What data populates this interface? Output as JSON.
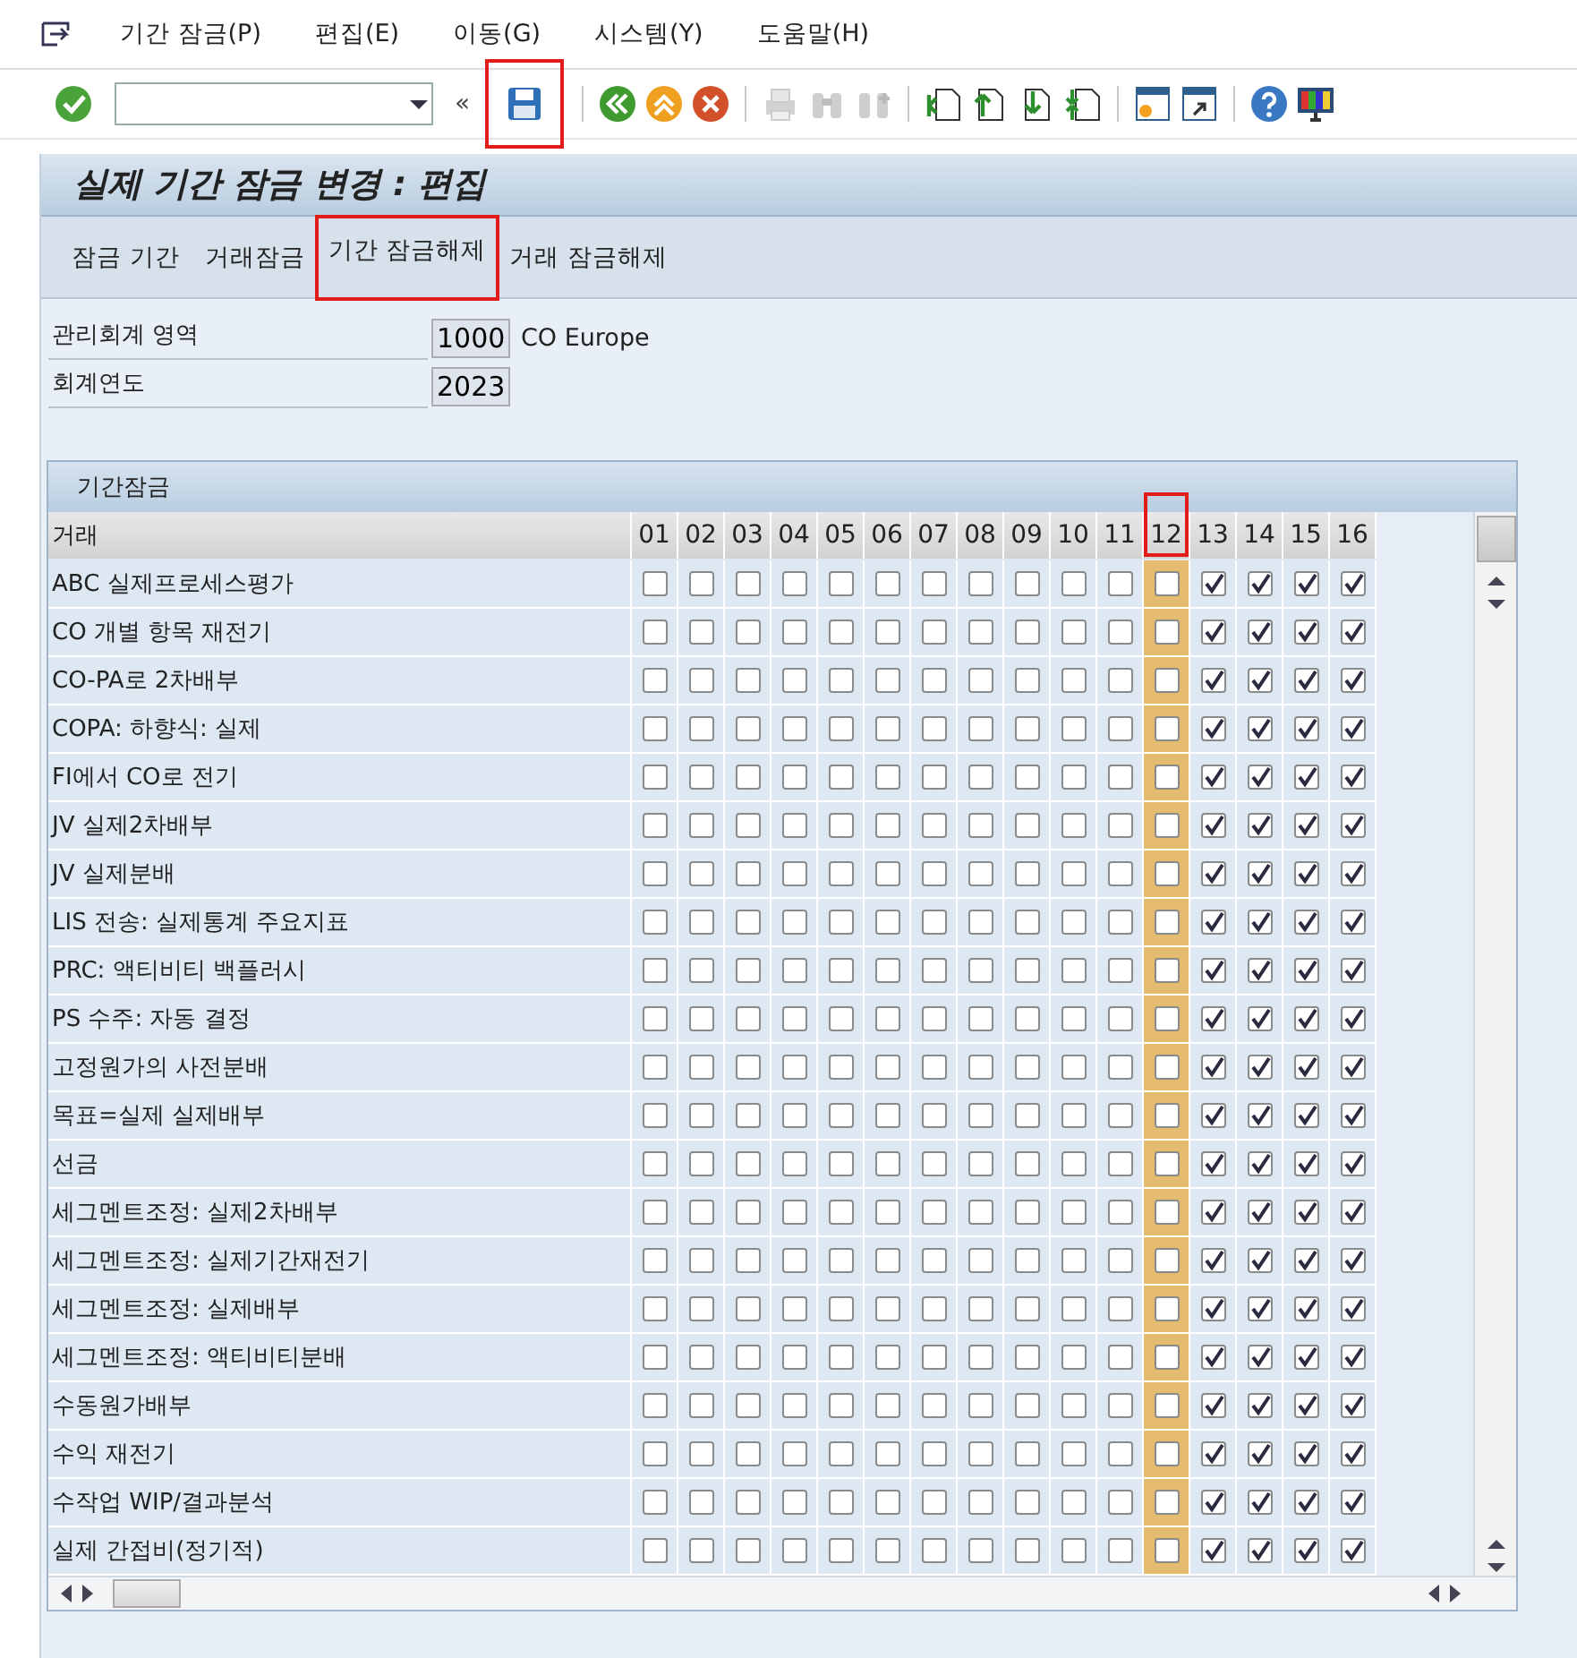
{
  "menu": [
    {
      "label": "기간 잠금(P)"
    },
    {
      "label": "편집(E)"
    },
    {
      "label": "이동(G)"
    },
    {
      "label": "시스템(Y)"
    },
    {
      "label": "도움말(H)"
    }
  ],
  "toolbar": {
    "collapse_glyph": "«",
    "buttons": [
      {
        "kind": "save",
        "disabled": false,
        "highlighted": true
      },
      {
        "kind": "sep"
      },
      {
        "kind": "back",
        "disabled": false,
        "highlighted": false
      },
      {
        "kind": "exit",
        "disabled": false,
        "highlighted": false
      },
      {
        "kind": "cancel",
        "disabled": false,
        "highlighted": false
      },
      {
        "kind": "sep"
      },
      {
        "kind": "print",
        "disabled": true,
        "highlighted": false
      },
      {
        "kind": "find",
        "disabled": true,
        "highlighted": false
      },
      {
        "kind": "find-next",
        "disabled": true,
        "highlighted": false
      },
      {
        "kind": "sep"
      },
      {
        "kind": "first-page",
        "disabled": false,
        "highlighted": false
      },
      {
        "kind": "prev-page",
        "disabled": false,
        "highlighted": false
      },
      {
        "kind": "next-page",
        "disabled": false,
        "highlighted": false
      },
      {
        "kind": "last-page",
        "disabled": false,
        "highlighted": false
      },
      {
        "kind": "sep"
      },
      {
        "kind": "new-session",
        "disabled": false,
        "highlighted": false
      },
      {
        "kind": "shortcut",
        "disabled": false,
        "highlighted": false
      },
      {
        "kind": "sep"
      },
      {
        "kind": "help",
        "disabled": false,
        "highlighted": false
      },
      {
        "kind": "layout",
        "disabled": false,
        "highlighted": false
      }
    ]
  },
  "title": "실제 기간 잠금 변경 : 편집",
  "tabs": [
    {
      "label": "잠금 기간",
      "highlighted": false
    },
    {
      "label": "거래잠금",
      "highlighted": false
    },
    {
      "label": "기간 잠금해제",
      "highlighted": true
    },
    {
      "label": "거래 잠금해제",
      "highlighted": false
    }
  ],
  "fields": [
    {
      "label": "관리회계 영역",
      "value": "1000",
      "description": "CO Europe"
    },
    {
      "label": "회계연도",
      "value": "2023"
    }
  ],
  "lock_table": {
    "title": "기간잠금",
    "first_column": "거래",
    "columns": [
      {
        "label": "01",
        "selected": false,
        "highlighted": false
      },
      {
        "label": "02",
        "selected": false,
        "highlighted": false
      },
      {
        "label": "03",
        "selected": false,
        "highlighted": false
      },
      {
        "label": "04",
        "selected": false,
        "highlighted": false
      },
      {
        "label": "05",
        "selected": false,
        "highlighted": false
      },
      {
        "label": "06",
        "selected": false,
        "highlighted": false
      },
      {
        "label": "07",
        "selected": false,
        "highlighted": false
      },
      {
        "label": "08",
        "selected": false,
        "highlighted": false
      },
      {
        "label": "09",
        "selected": false,
        "highlighted": false
      },
      {
        "label": "10",
        "selected": false,
        "highlighted": false
      },
      {
        "label": "11",
        "selected": false,
        "highlighted": false
      },
      {
        "label": "12",
        "selected": true,
        "highlighted": true
      },
      {
        "label": "13",
        "selected": false,
        "highlighted": false
      },
      {
        "label": "14",
        "selected": false,
        "highlighted": false
      },
      {
        "label": "15",
        "selected": false,
        "highlighted": false
      },
      {
        "label": "16",
        "selected": false,
        "highlighted": false
      }
    ],
    "rows": [
      {
        "label": "ABC 실제프로세스평가",
        "checks": [
          false,
          false,
          false,
          false,
          false,
          false,
          false,
          false,
          false,
          false,
          false,
          false,
          true,
          true,
          true,
          true
        ]
      },
      {
        "label": "CO 개별 항목 재전기",
        "checks": [
          false,
          false,
          false,
          false,
          false,
          false,
          false,
          false,
          false,
          false,
          false,
          false,
          true,
          true,
          true,
          true
        ]
      },
      {
        "label": "CO-PA로 2차배부",
        "checks": [
          false,
          false,
          false,
          false,
          false,
          false,
          false,
          false,
          false,
          false,
          false,
          false,
          true,
          true,
          true,
          true
        ]
      },
      {
        "label": "COPA: 하향식: 실제",
        "checks": [
          false,
          false,
          false,
          false,
          false,
          false,
          false,
          false,
          false,
          false,
          false,
          false,
          true,
          true,
          true,
          true
        ]
      },
      {
        "label": "FI에서 CO로 전기",
        "checks": [
          false,
          false,
          false,
          false,
          false,
          false,
          false,
          false,
          false,
          false,
          false,
          false,
          true,
          true,
          true,
          true
        ]
      },
      {
        "label": "JV 실제2차배부",
        "checks": [
          false,
          false,
          false,
          false,
          false,
          false,
          false,
          false,
          false,
          false,
          false,
          false,
          true,
          true,
          true,
          true
        ]
      },
      {
        "label": "JV 실제분배",
        "checks": [
          false,
          false,
          false,
          false,
          false,
          false,
          false,
          false,
          false,
          false,
          false,
          false,
          true,
          true,
          true,
          true
        ]
      },
      {
        "label": "LIS 전송: 실제통계 주요지표",
        "checks": [
          false,
          false,
          false,
          false,
          false,
          false,
          false,
          false,
          false,
          false,
          false,
          false,
          true,
          true,
          true,
          true
        ]
      },
      {
        "label": "PRC: 액티비티 백플러시",
        "checks": [
          false,
          false,
          false,
          false,
          false,
          false,
          false,
          false,
          false,
          false,
          false,
          false,
          true,
          true,
          true,
          true
        ]
      },
      {
        "label": "PS 수주: 자동 결정",
        "checks": [
          false,
          false,
          false,
          false,
          false,
          false,
          false,
          false,
          false,
          false,
          false,
          false,
          true,
          true,
          true,
          true
        ]
      },
      {
        "label": "고정원가의 사전분배",
        "checks": [
          false,
          false,
          false,
          false,
          false,
          false,
          false,
          false,
          false,
          false,
          false,
          false,
          true,
          true,
          true,
          true
        ]
      },
      {
        "label": "목표=실제 실제배부",
        "checks": [
          false,
          false,
          false,
          false,
          false,
          false,
          false,
          false,
          false,
          false,
          false,
          false,
          true,
          true,
          true,
          true
        ]
      },
      {
        "label": "선금",
        "checks": [
          false,
          false,
          false,
          false,
          false,
          false,
          false,
          false,
          false,
          false,
          false,
          false,
          true,
          true,
          true,
          true
        ]
      },
      {
        "label": "세그멘트조정: 실제2차배부",
        "checks": [
          false,
          false,
          false,
          false,
          false,
          false,
          false,
          false,
          false,
          false,
          false,
          false,
          true,
          true,
          true,
          true
        ]
      },
      {
        "label": "세그멘트조정: 실제기간재전기",
        "checks": [
          false,
          false,
          false,
          false,
          false,
          false,
          false,
          false,
          false,
          false,
          false,
          false,
          true,
          true,
          true,
          true
        ]
      },
      {
        "label": "세그멘트조정: 실제배부",
        "checks": [
          false,
          false,
          false,
          false,
          false,
          false,
          false,
          false,
          false,
          false,
          false,
          false,
          true,
          true,
          true,
          true
        ]
      },
      {
        "label": "세그멘트조정: 액티비티분배",
        "checks": [
          false,
          false,
          false,
          false,
          false,
          false,
          false,
          false,
          false,
          false,
          false,
          false,
          true,
          true,
          true,
          true
        ]
      },
      {
        "label": "수동원가배부",
        "checks": [
          false,
          false,
          false,
          false,
          false,
          false,
          false,
          false,
          false,
          false,
          false,
          false,
          true,
          true,
          true,
          true
        ]
      },
      {
        "label": "수익 재전기",
        "checks": [
          false,
          false,
          false,
          false,
          false,
          false,
          false,
          false,
          false,
          false,
          false,
          false,
          true,
          true,
          true,
          true
        ]
      },
      {
        "label": "수작업 WIP/결과분석",
        "checks": [
          false,
          false,
          false,
          false,
          false,
          false,
          false,
          false,
          false,
          false,
          false,
          false,
          true,
          true,
          true,
          true
        ]
      },
      {
        "label": "실제 간접비(정기적)",
        "checks": [
          false,
          false,
          false,
          false,
          false,
          false,
          false,
          false,
          false,
          false,
          false,
          false,
          true,
          true,
          true,
          true
        ]
      }
    ]
  }
}
